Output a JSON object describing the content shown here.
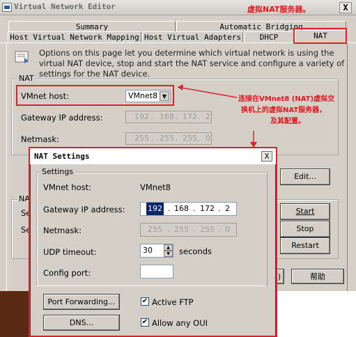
{
  "window": {
    "title": "Virtual Network Editor",
    "close_glyph": "X"
  },
  "tabs": {
    "row_back": [
      "Summary",
      "Automatic Bridging"
    ],
    "row_front": [
      "Host Virtual Network Mapping",
      "Host Virtual Adapters",
      "DHCP",
      "NAT"
    ]
  },
  "annotations": {
    "top": "虚拟NAT服务器。",
    "middle_lines": [
      "连接在VMnet8 (NAT)虚拟交",
      "换机上的虚拟NAT服务器，",
      "及其配置。"
    ]
  },
  "intro": "Options on this page let you determine which virtual network is using the virtual NAT device, stop and start the NAT service and configure a variety of settings for the NAT device.",
  "nat_group": {
    "label": "NAT",
    "vmnet_host_label": "VMnet host:",
    "vmnet_host_value": "VMnet8",
    "gateway_label": "Gateway IP address:",
    "gateway": [
      "192",
      "168",
      "172",
      "2"
    ],
    "netmask_label": "Netmask:",
    "netmask": [
      "255",
      "255",
      "255",
      "0"
    ],
    "edit_button": "Edit..."
  },
  "service_group": {
    "label_partial": "NAT",
    "row1_partial": "Ser",
    "row2_partial": "Ser",
    "start_button": "Start",
    "stop_button": "Stop",
    "restart_button": "Restart"
  },
  "main_buttons": {
    "partial_paren": ")",
    "help": "帮助"
  },
  "dialog": {
    "title": "NAT Settings",
    "close_glyph": "X",
    "settings_group": "Settings",
    "vmnet_host_label": "VMnet host:",
    "vmnet_host_value": "VMnet8",
    "gateway_label": "Gateway IP address:",
    "gateway": [
      "192",
      "168",
      "172",
      "2"
    ],
    "netmask_label": "Netmask:",
    "netmask": [
      "255",
      "255",
      "255",
      "0"
    ],
    "udp_timeout_label": "UDP timeout:",
    "udp_timeout_value": "30",
    "udp_timeout_unit": "seconds",
    "config_port_label": "Config port:",
    "config_port_value": "",
    "port_forwarding_button": "Port Forwarding...",
    "dns_button": "DNS...",
    "active_ftp_label": "Active FTP",
    "active_ftp_checked": true,
    "allow_oui_label": "Allow any OUI",
    "allow_oui_checked": true
  },
  "colors": {
    "annotation_red": "#d8232a",
    "selection_blue": "#0a246a"
  }
}
